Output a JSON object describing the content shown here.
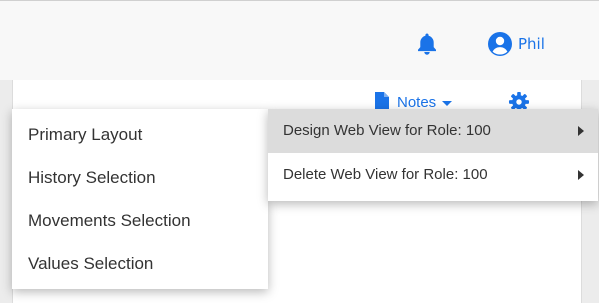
{
  "header": {
    "user_name": "Phil",
    "accent_color": "#1a73e8",
    "icons": [
      "bell-icon",
      "user-circle-icon"
    ]
  },
  "toolbar": {
    "notes_label": "Notes",
    "icons": [
      "document-icon",
      "caret-down-icon",
      "gear-icon"
    ]
  },
  "context_menu": {
    "items": [
      {
        "label": "Primary Layout"
      },
      {
        "label": "History Selection"
      },
      {
        "label": "Movements Selection"
      },
      {
        "label": "Values Selection"
      }
    ]
  },
  "submenu": {
    "items": [
      {
        "label": "Design Web View for Role: 100",
        "highlighted": true
      },
      {
        "label": "Delete Web View for Role: 100",
        "highlighted": false
      }
    ]
  }
}
